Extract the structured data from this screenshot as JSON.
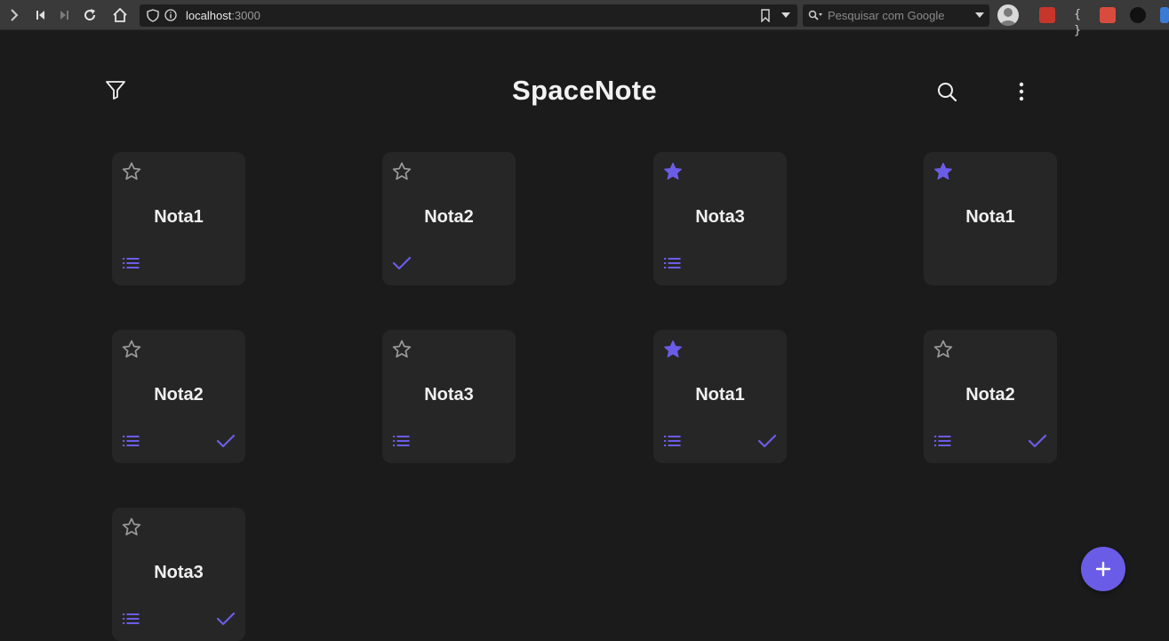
{
  "browser": {
    "url_host": "localhost",
    "url_port": ":3000",
    "search_placeholder": "Pesquisar com Google"
  },
  "app": {
    "title": "SpaceNote",
    "accent_color": "#6b5ce7"
  },
  "notes": [
    {
      "title": "Nota1",
      "starred": false,
      "has_list": true,
      "done": false
    },
    {
      "title": "Nota2",
      "starred": false,
      "has_list": false,
      "done": true
    },
    {
      "title": "Nota3",
      "starred": true,
      "has_list": true,
      "done": false
    },
    {
      "title": "Nota1",
      "starred": true,
      "has_list": false,
      "done": false
    },
    {
      "title": "Nota2",
      "starred": false,
      "has_list": true,
      "done": true
    },
    {
      "title": "Nota3",
      "starred": false,
      "has_list": true,
      "done": false
    },
    {
      "title": "Nota1",
      "starred": true,
      "has_list": true,
      "done": true
    },
    {
      "title": "Nota2",
      "starred": false,
      "has_list": true,
      "done": true
    },
    {
      "title": "Nota3",
      "starred": false,
      "has_list": true,
      "done": true
    }
  ],
  "fab_label": "+"
}
